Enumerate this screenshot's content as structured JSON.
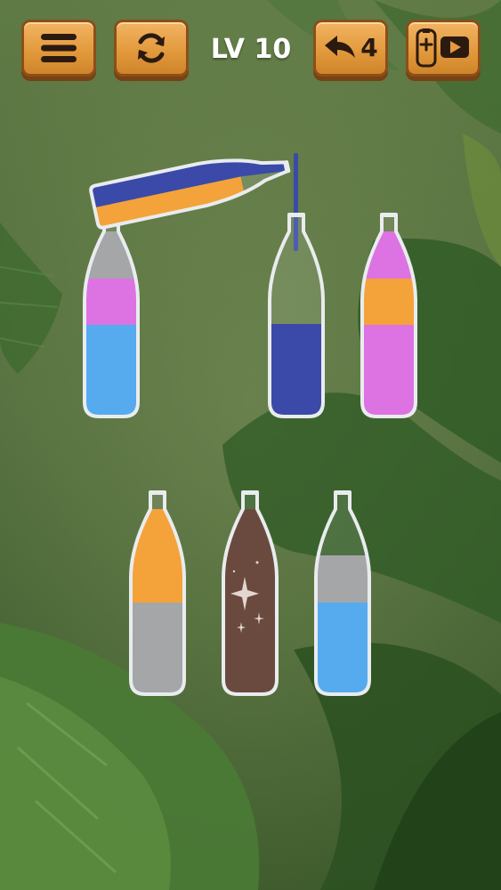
{
  "header": {
    "level_text": "LV 10",
    "undo_count": "4"
  },
  "icons": {
    "menu": "hamburger-menu-icon",
    "restart": "refresh-icon",
    "undo": "undo-arrow-icon",
    "add_bottle_ad": "add-bottle-video-icon"
  },
  "colors": {
    "blue": "#3b4aa8",
    "orange": "#f4a23a",
    "gray": "#a4a6a8",
    "pink": "#dd72e3",
    "light_blue": "#55abee",
    "brown": "#6a4a3f",
    "button": "#e39a3d"
  },
  "game": {
    "pouring_bottle": {
      "from_slot": 1,
      "to_slot": 2,
      "layers": [
        "orange",
        "blue"
      ]
    },
    "bottles": [
      {
        "slot": 1,
        "layers": [
          "light_blue",
          "light_blue",
          "pink",
          "gray"
        ]
      },
      {
        "slot": 2,
        "layers": [
          "blue",
          "blue"
        ]
      },
      {
        "slot": 3,
        "layers": [
          "pink",
          "pink",
          "orange",
          "pink"
        ]
      },
      {
        "slot": 4,
        "layers": [
          "gray",
          "gray",
          "orange",
          "orange"
        ]
      },
      {
        "slot": 5,
        "layers": [
          "brown",
          "brown",
          "brown",
          "brown"
        ],
        "completed": true
      },
      {
        "slot": 6,
        "layers": [
          "light_blue",
          "light_blue",
          "gray"
        ]
      }
    ]
  }
}
